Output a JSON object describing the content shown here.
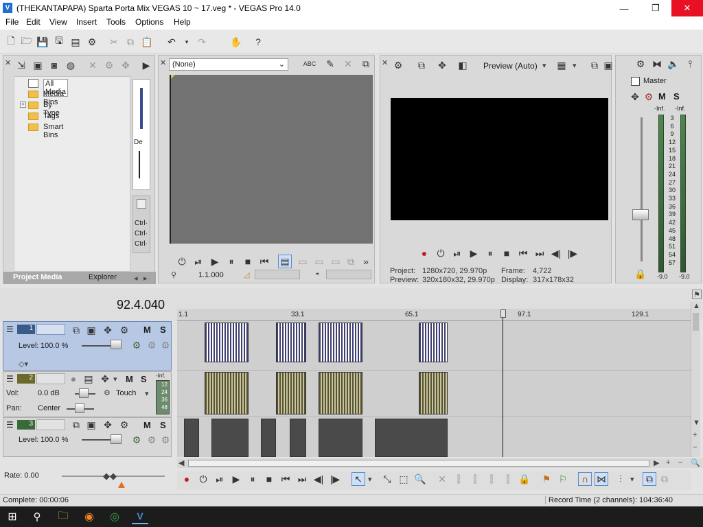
{
  "window": {
    "title": "(THEKANTAPAPA) Sparta Porta Mix VEGAS 10 ~ 17.veg * - VEGAS Pro 14.0",
    "minimize": "—",
    "maximize": "❐",
    "close": "✕"
  },
  "menu": [
    "File",
    "Edit",
    "View",
    "Insert",
    "Tools",
    "Options",
    "Help"
  ],
  "project_media": {
    "tree": [
      {
        "label": "All Media",
        "selected": true
      },
      {
        "label": "Media Bins"
      },
      {
        "label": "By Type",
        "expandable": true,
        "expand_glyph": "+"
      },
      {
        "label": "Tags"
      },
      {
        "label": "Smart Bins"
      }
    ],
    "tabs": [
      "Project Media",
      "Explorer"
    ],
    "side_labels": [
      "De",
      "Ctrl·",
      "Ctrl·",
      "Ctrl·"
    ]
  },
  "trimmer": {
    "dropdown_value": "(None)",
    "timecode": "1.1.000"
  },
  "preview": {
    "mode": "Preview (Auto)",
    "info": {
      "project_label": "Project:",
      "project_value": "1280x720, 29.970p",
      "preview_label": "Preview:",
      "preview_value": "320x180x32, 29.970p",
      "frame_label": "Frame:",
      "frame_value": "4,722",
      "display_label": "Display:",
      "display_value": "317x178x32"
    }
  },
  "master": {
    "title": "Master",
    "mute": "M",
    "solo": "S",
    "peak_left": "-Inf.",
    "peak_right": "-Inf.",
    "scale": [
      "3",
      "6",
      "9",
      "12",
      "15",
      "18",
      "21",
      "24",
      "27",
      "30",
      "33",
      "36",
      "39",
      "42",
      "45",
      "48",
      "51",
      "54",
      "57"
    ],
    "bottom_left": "-9.0",
    "bottom_right": "-9.0"
  },
  "timeline": {
    "cursor_time": "92.4.040",
    "ruler_marks": [
      "1.1",
      "33.1",
      "65.1",
      "97.1",
      "129.1"
    ],
    "tracks": [
      {
        "number": "1",
        "type": "video",
        "level_label": "Level:",
        "level_value": "100.0 %",
        "mute": "M",
        "solo": "S"
      },
      {
        "number": "2",
        "type": "audio",
        "vol_label": "Vol:",
        "vol_value": "0.0 dB",
        "pan_label": "Pan:",
        "pan_value": "Center",
        "automation": "Touch",
        "mute": "M",
        "solo": "S",
        "meter_peak": "-Inf.",
        "meter_scale": [
          "12",
          "24",
          "36",
          "48"
        ]
      },
      {
        "number": "3",
        "type": "video",
        "level_label": "Level:",
        "level_value": "100.0 %",
        "mute": "M",
        "solo": "S"
      }
    ]
  },
  "transport": {
    "rate_label": "Rate: 0.00"
  },
  "status": {
    "left": "Complete: 00:00:06",
    "right": "Record Time (2 channels): 104:36:40"
  },
  "taskbar": {
    "apps": [
      "windows-start",
      "search",
      "file-explorer",
      "firefox",
      "chrome",
      "vegas-pro"
    ]
  }
}
